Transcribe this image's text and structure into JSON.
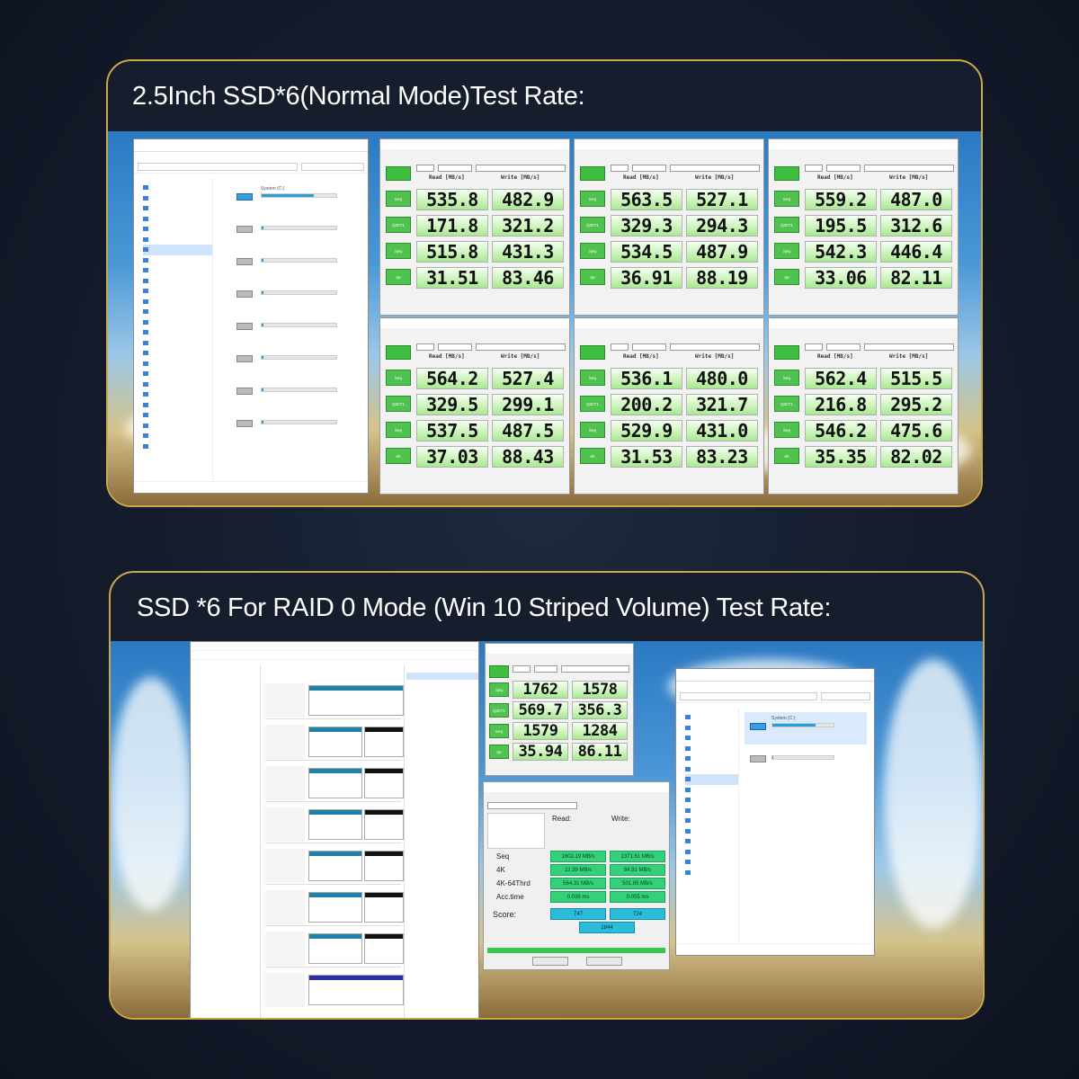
{
  "panel1": {
    "title": "2.5Inch SSD*6(Normal Mode)Test Rate:",
    "col_read": "Read [MB/s]",
    "col_write": "Write [MB/s]",
    "row_labels": [
      "Seq",
      "Q32T1",
      "Seq",
      "4K"
    ],
    "benchmarks": [
      {
        "read": [
          "535.8",
          "171.8",
          "515.8",
          "31.51"
        ],
        "write": [
          "482.9",
          "321.2",
          "431.3",
          "83.46"
        ]
      },
      {
        "read": [
          "563.5",
          "329.3",
          "534.5",
          "36.91"
        ],
        "write": [
          "527.1",
          "294.3",
          "487.9",
          "88.19"
        ]
      },
      {
        "read": [
          "559.2",
          "195.5",
          "542.3",
          "33.06"
        ],
        "write": [
          "487.0",
          "312.6",
          "446.4",
          "82.11"
        ]
      },
      {
        "read": [
          "564.2",
          "329.5",
          "537.5",
          "37.03"
        ],
        "write": [
          "527.4",
          "299.1",
          "487.5",
          "88.43"
        ]
      },
      {
        "read": [
          "536.1",
          "200.2",
          "529.9",
          "31.53"
        ],
        "write": [
          "480.0",
          "321.7",
          "431.0",
          "83.23"
        ]
      },
      {
        "read": [
          "562.4",
          "216.8",
          "546.2",
          "35.35"
        ],
        "write": [
          "515.5",
          "295.2",
          "475.6",
          "82.02"
        ]
      }
    ],
    "explorer_drive_label": "System (C:)"
  },
  "panel2": {
    "title": "SSD *6 For RAID 0 Mode (Win 10 Striped Volume) Test Rate:",
    "crystal": {
      "read": [
        "1762",
        "569.7",
        "1579",
        "35.94"
      ],
      "write": [
        "1578",
        "356.3",
        "1284",
        "86.11"
      ]
    },
    "asssd": {
      "header_read": "Read:",
      "header_write": "Write:",
      "rows": [
        {
          "label": "Seq",
          "read": "1602.19 MB/s",
          "write": "1371.61 MB/s"
        },
        {
          "label": "4K",
          "read": "22.39 MB/s",
          "write": "84.91 MB/s"
        },
        {
          "label": "4K-64Thrd",
          "read": "564.31 MB/s",
          "write": "501.85 MB/s"
        },
        {
          "label": "Acc.time",
          "read": "0.038 ms",
          "write": "0.055 ms"
        }
      ],
      "score_label": "Score:",
      "score_read": "747",
      "score_write": "724",
      "score_total": "1844"
    },
    "explorer_drive_label": "System (C:)"
  }
}
